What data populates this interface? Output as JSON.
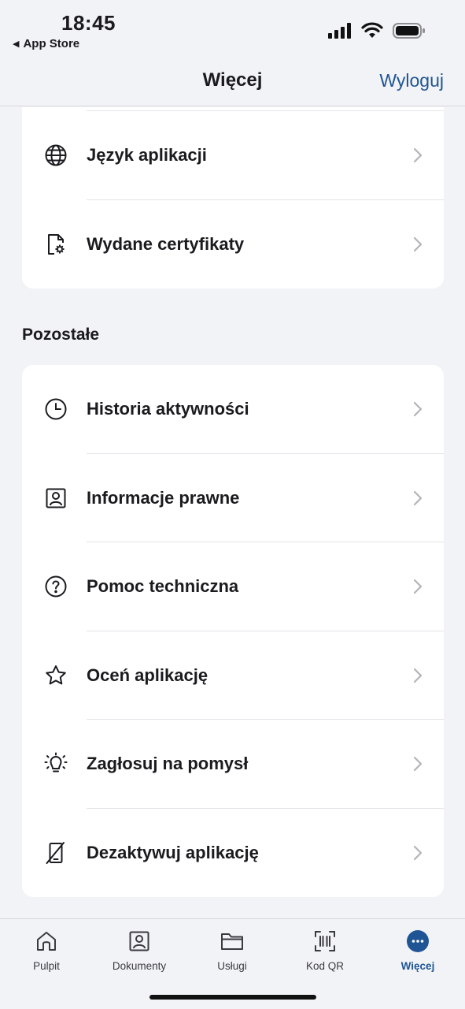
{
  "status_bar": {
    "time": "18:45",
    "back_app": "App Store"
  },
  "header": {
    "title": "Więcej",
    "logout": "Wyloguj"
  },
  "top_card": {
    "items": [
      {
        "label": "Język aplikacji",
        "icon": "globe-icon"
      },
      {
        "label": "Wydane certyfikaty",
        "icon": "certificate-icon"
      }
    ]
  },
  "section": {
    "title": "Pozostałe",
    "items": [
      {
        "label": "Historia aktywności",
        "icon": "clock-icon"
      },
      {
        "label": "Informacje prawne",
        "icon": "id-card-icon"
      },
      {
        "label": "Pomoc techniczna",
        "icon": "help-icon"
      },
      {
        "label": "Oceń aplikację",
        "icon": "star-icon"
      },
      {
        "label": "Zagłosuj na pomysł",
        "icon": "lightbulb-icon"
      },
      {
        "label": "Dezaktywuj aplikację",
        "icon": "phone-off-icon"
      }
    ]
  },
  "tabs": [
    {
      "label": "Pulpit",
      "icon": "home-icon"
    },
    {
      "label": "Dokumenty",
      "icon": "document-icon"
    },
    {
      "label": "Usługi",
      "icon": "folder-icon"
    },
    {
      "label": "Kod QR",
      "icon": "qr-scan-icon"
    },
    {
      "label": "Więcej",
      "icon": "more-icon",
      "active": true
    }
  ],
  "colors": {
    "accent": "#1f5595",
    "background": "#f2f3f7",
    "card": "#ffffff"
  }
}
